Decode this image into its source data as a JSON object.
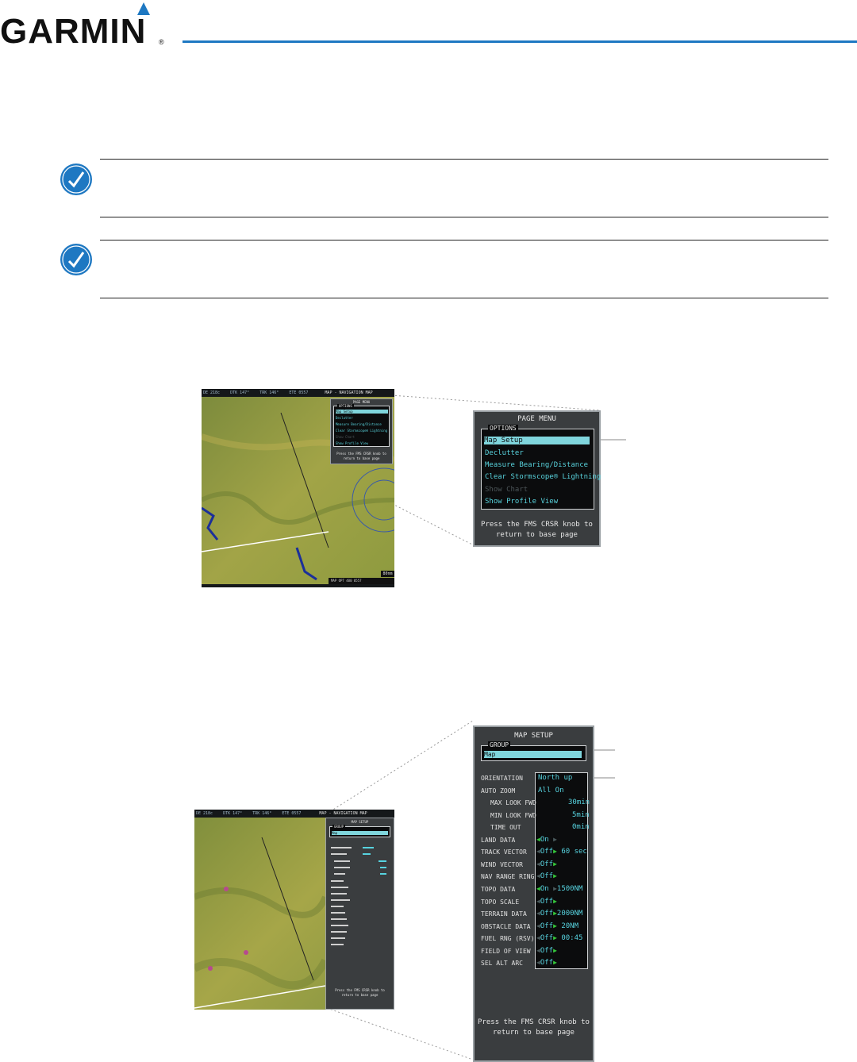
{
  "brand": {
    "name": "GARMIN",
    "mark": "®",
    "accent": "#1e78c2"
  },
  "notes": [
    {
      "icon": "note-icon"
    },
    {
      "icon": "note-icon"
    }
  ],
  "figure1": {
    "thumb": {
      "topbar": [
        "DE 218c",
        "DTK 147°",
        "TRK 146°",
        "ETE 0557",
        "MAP - NAVIGATION MAP"
      ],
      "menu_title": "PAGE MENU",
      "options_label": "OPTIONS",
      "items": [
        "Map Setup",
        "Declutter",
        "Measure Bearing/Distance",
        "Clear Stormscope® Lightning",
        "Show Chart",
        "Show Profile View"
      ],
      "footer": [
        "Press the FMS CRSR knob to",
        "return to base page"
      ],
      "scale": "80nm",
      "bottom_status": "MAP OPT 400 0557"
    },
    "zoom": {
      "menu_title": "PAGE MENU",
      "options_label": "OPTIONS",
      "items": [
        {
          "label": "Map Setup",
          "state": "selected"
        },
        {
          "label": "Declutter",
          "state": "normal"
        },
        {
          "label": "Measure Bearing/Distance",
          "state": "normal"
        },
        {
          "label": "Clear Stormscope® Lightning",
          "state": "normal"
        },
        {
          "label": "Show Chart",
          "state": "disabled"
        },
        {
          "label": "Show Profile View",
          "state": "normal"
        }
      ],
      "footer_line1": "Press the FMS CRSR knob to",
      "footer_line2": "return to base page"
    }
  },
  "figure2": {
    "thumb": {
      "topbar": [
        "DE 218c",
        "DTK 147°",
        "TRK 146°",
        "ETE 0557",
        "MAP - NAVIGATION MAP"
      ],
      "title": "MAP SETUP",
      "group_label": "GROUP",
      "group_value": "Map",
      "footer": [
        "Press the FMS CRSR knob to",
        "return to base page"
      ]
    },
    "zoom": {
      "title": "MAP SETUP",
      "group_label": "GROUP",
      "group_value": "Map",
      "rows": [
        {
          "label": "ORIENTATION",
          "value": "North up",
          "indent": false
        },
        {
          "label": "AUTO ZOOM",
          "value": "All On",
          "indent": false
        },
        {
          "label": "MAX LOOK FWD",
          "value": "30min",
          "indent": true
        },
        {
          "label": "MIN LOOK FWD",
          "value": "5min",
          "indent": true
        },
        {
          "label": "TIME OUT",
          "value": "0min",
          "indent": true
        },
        {
          "label": "LAND DATA",
          "value": "On",
          "extra": "",
          "indent": false
        },
        {
          "label": "TRACK VECTOR",
          "value": "Off",
          "extra": "60 sec",
          "indent": false
        },
        {
          "label": "WIND VECTOR",
          "value": "Off",
          "extra": "",
          "indent": false
        },
        {
          "label": "NAV RANGE RING",
          "value": "Off",
          "extra": "",
          "indent": false
        },
        {
          "label": "TOPO DATA",
          "value": "On",
          "extra": "1500NM",
          "indent": false
        },
        {
          "label": "TOPO SCALE",
          "value": "Off",
          "extra": "",
          "indent": false
        },
        {
          "label": "TERRAIN DATA",
          "value": "Off",
          "extra": "2000NM",
          "indent": false
        },
        {
          "label": "OBSTACLE DATA",
          "value": "Off",
          "extra": "20NM",
          "indent": false
        },
        {
          "label": "FUEL RNG (RSV)",
          "value": "Off",
          "extra": "00:45",
          "indent": false
        },
        {
          "label": "FIELD OF VIEW",
          "value": "Off",
          "extra": "",
          "indent": false
        },
        {
          "label": "SEL ALT ARC",
          "value": "Off",
          "extra": "",
          "indent": false
        }
      ],
      "footer_line1": "Press the FMS CRSR knob to",
      "footer_line2": "return to base page"
    }
  }
}
